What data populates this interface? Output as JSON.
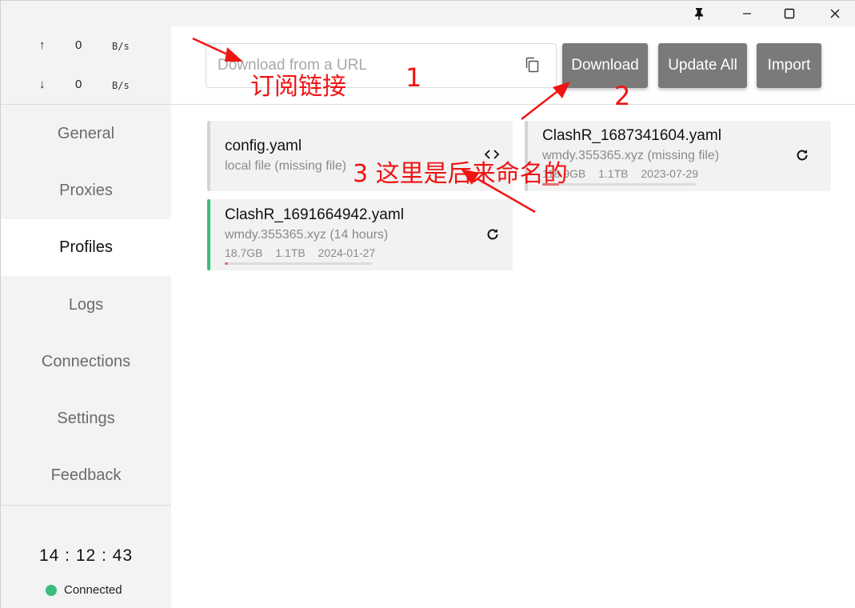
{
  "window": {
    "pin_icon": "pin-icon",
    "minimize_icon": "minimize-icon",
    "maximize_icon": "maximize-icon",
    "close_icon": "close-icon"
  },
  "traffic": {
    "upload": {
      "arrow": "↑",
      "value": "0",
      "unit": "B/s"
    },
    "download": {
      "arrow": "↓",
      "value": "0",
      "unit": "B/s"
    }
  },
  "nav": {
    "items": [
      {
        "label": "General"
      },
      {
        "label": "Proxies"
      },
      {
        "label": "Profiles"
      },
      {
        "label": "Logs"
      },
      {
        "label": "Connections"
      },
      {
        "label": "Settings"
      },
      {
        "label": "Feedback"
      }
    ],
    "active": "Profiles"
  },
  "status": {
    "clock": "14 : 12 : 43",
    "connection": "Connected",
    "connection_color": "#3dbb7d"
  },
  "toolbar": {
    "url_placeholder": "Download from a URL",
    "download_label": "Download",
    "update_all_label": "Update All",
    "import_label": "Import"
  },
  "profiles": [
    {
      "name": "config.yaml",
      "subtitle": "local file (missing file)",
      "icon": "code-icon"
    },
    {
      "name": "ClashR_1687341604.yaml",
      "subtitle": "wmdy.355365.xyz (missing file)",
      "used": "118.9GB",
      "total": "1.1TB",
      "expire": "2023-07-29",
      "icon": "refresh-icon"
    },
    {
      "name": "ClashR_1691664942.yaml",
      "subtitle": "wmdy.355365.xyz (14 hours)",
      "used": "18.7GB",
      "total": "1.1TB",
      "expire": "2024-01-27",
      "icon": "refresh-icon",
      "active": true
    }
  ],
  "annotations": {
    "a1_text": "订阅链接",
    "a1_num": "1",
    "a2_num": "2",
    "a3_text": "3 这里是后来命名的",
    "color": "#f01414"
  }
}
